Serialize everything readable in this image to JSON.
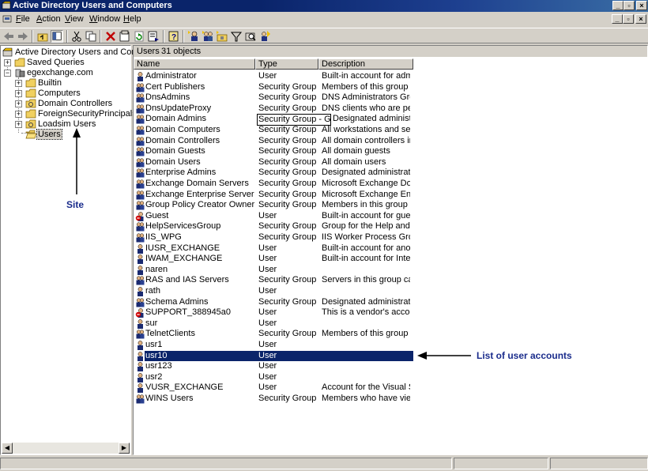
{
  "window": {
    "title": "Active Directory Users and Computers"
  },
  "menu": {
    "items": [
      "File",
      "Action",
      "View",
      "Window",
      "Help"
    ]
  },
  "tree": {
    "root": "Active Directory Users and Computers",
    "saved_queries": "Saved Queries",
    "domain": "egexchange.com",
    "children": [
      "Builtin",
      "Computers",
      "Domain Controllers",
      "ForeignSecurityPrincipals",
      "Loadsim Users",
      "Users"
    ]
  },
  "list": {
    "header_title": "Users",
    "header_count": "31 objects",
    "columns": [
      "Name",
      "Type",
      "Description"
    ],
    "rows": [
      {
        "name": "Administrator",
        "type": "User",
        "desc": "Built-in account for admini...",
        "icon": "user-icon"
      },
      {
        "name": "Cert Publishers",
        "type": "Security Group ...",
        "desc": "Members of this group are...",
        "icon": "group-icon"
      },
      {
        "name": "DnsAdmins",
        "type": "Security Group ...",
        "desc": "DNS Administrators Group",
        "icon": "group-icon"
      },
      {
        "name": "DnsUpdateProxy",
        "type": "Security Group ...",
        "desc": "DNS clients who are permi...",
        "icon": "group-icon"
      },
      {
        "name": "Domain Admins",
        "type": "Security Group - Global",
        "desc": "Designated administrators...",
        "icon": "group-icon"
      },
      {
        "name": "Domain Computers",
        "type": "Security Group ...",
        "desc": "All workstations and serve...",
        "icon": "group-icon"
      },
      {
        "name": "Domain Controllers",
        "type": "Security Group ...",
        "desc": "All domain controllers in th...",
        "icon": "group-icon"
      },
      {
        "name": "Domain Guests",
        "type": "Security Group ...",
        "desc": "All domain guests",
        "icon": "group-icon"
      },
      {
        "name": "Domain Users",
        "type": "Security Group ...",
        "desc": "All domain users",
        "icon": "group-icon"
      },
      {
        "name": "Enterprise Admins",
        "type": "Security Group ...",
        "desc": "Designated administrators...",
        "icon": "group-icon"
      },
      {
        "name": "Exchange Domain Servers",
        "type": "Security Group ...",
        "desc": "Microsoft Exchange Domai...",
        "icon": "group-icon"
      },
      {
        "name": "Exchange Enterprise Servers",
        "type": "Security Group ...",
        "desc": "Microsoft Exchange Enter...",
        "icon": "group-icon"
      },
      {
        "name": "Group Policy Creator Owners",
        "type": "Security Group ...",
        "desc": "Members in this group can...",
        "icon": "group-icon"
      },
      {
        "name": "Guest",
        "type": "User",
        "desc": "Built-in account for guest ...",
        "icon": "disabled-user-icon"
      },
      {
        "name": "HelpServicesGroup",
        "type": "Security Group ...",
        "desc": "Group for the Help and Su...",
        "icon": "group-icon"
      },
      {
        "name": "IIS_WPG",
        "type": "Security Group ...",
        "desc": "IIS Worker Process Group",
        "icon": "group-icon"
      },
      {
        "name": "IUSR_EXCHANGE",
        "type": "User",
        "desc": "Built-in account for anony...",
        "icon": "user-icon"
      },
      {
        "name": "IWAM_EXCHANGE",
        "type": "User",
        "desc": "Built-in account for Intern...",
        "icon": "user-icon"
      },
      {
        "name": "naren",
        "type": "User",
        "desc": "",
        "icon": "user-icon"
      },
      {
        "name": "RAS and IAS Servers",
        "type": "Security Group ...",
        "desc": "Servers in this group can ...",
        "icon": "group-icon"
      },
      {
        "name": "rath",
        "type": "User",
        "desc": "",
        "icon": "user-icon"
      },
      {
        "name": "Schema Admins",
        "type": "Security Group ...",
        "desc": "Designated administrators...",
        "icon": "group-icon"
      },
      {
        "name": "SUPPORT_388945a0",
        "type": "User",
        "desc": "This is a vendor's account ...",
        "icon": "disabled-user-icon"
      },
      {
        "name": "sur",
        "type": "User",
        "desc": "",
        "icon": "user-icon"
      },
      {
        "name": "TelnetClients",
        "type": "Security Group ...",
        "desc": "Members of this group ha...",
        "icon": "group-icon"
      },
      {
        "name": "usr1",
        "type": "User",
        "desc": "",
        "icon": "user-icon"
      },
      {
        "name": "usr10",
        "type": "User",
        "desc": "",
        "icon": "user-icon"
      },
      {
        "name": "usr123",
        "type": "User",
        "desc": "",
        "icon": "user-icon"
      },
      {
        "name": "usr2",
        "type": "User",
        "desc": "",
        "icon": "user-icon"
      },
      {
        "name": "VUSR_EXCHANGE",
        "type": "User",
        "desc": "Account for the Visual Stu...",
        "icon": "user-icon"
      },
      {
        "name": "WINS Users",
        "type": "Security Group ...",
        "desc": "Members who have view-...",
        "icon": "group-icon"
      }
    ]
  },
  "annotations": {
    "site": "Site",
    "list": "List of user accounts"
  }
}
